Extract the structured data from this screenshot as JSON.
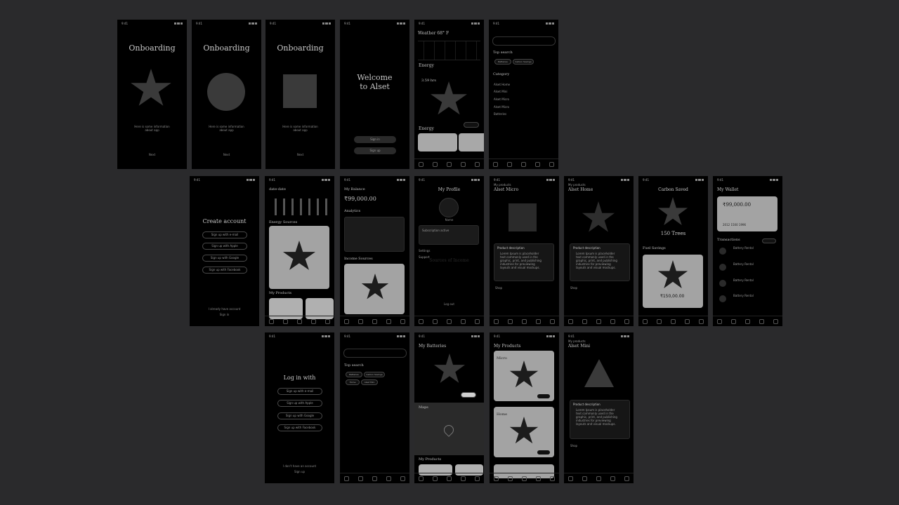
{
  "status_time": "9:41",
  "onboarding": {
    "title": "Onboarding",
    "info": "Here is some information about app",
    "next": "Next"
  },
  "welcome": {
    "title_line1": "Welcome",
    "title_line2": "to Alset",
    "sign_in": "Sign in",
    "sign_up": "Sign up"
  },
  "weather": {
    "title": "Weather 68° F",
    "energy": "Energy",
    "hours": "3.59 hrs",
    "energy2": "Energy"
  },
  "search": {
    "top_search": "Top search",
    "chips": [
      "Batteries",
      "Carbon Savings"
    ],
    "category": "Category",
    "categories": [
      "Alset Home",
      "Alset Mini",
      "Alset Micro",
      "Alset Micro",
      "Batteries"
    ]
  },
  "create_account": {
    "title": "Create account",
    "options": [
      "Sign up with e-mail",
      "Sign up with Apple",
      "Sign up with Google",
      "Sign up with Facebook"
    ],
    "already": "I already have account",
    "sign_in": "Sign in"
  },
  "dashboard": {
    "date": "date-date",
    "energy_sources": "Energy Sources",
    "my_products": "My Products"
  },
  "balance": {
    "title": "My Balance",
    "amount": "₹99,000.00",
    "analytics": "Analytics",
    "income_sources": "Income Sources"
  },
  "profile": {
    "title": "My Profile",
    "name": "Name",
    "subscription": "Subscription active",
    "settings": "Settings",
    "support": "Support",
    "sources": "Sources of Income",
    "logout": "Log out"
  },
  "alset_micro": {
    "back": "My products",
    "title": "Alset Micro",
    "desc_title": "Product description",
    "desc": "Lorem Ipsum is placeholder text commonly used in the graphic, print, and publishing industries for previewing layouts and visual mockups.",
    "shop": "Shop",
    "details": "Details"
  },
  "alset_home": {
    "back": "My products",
    "title": "Alset Home",
    "desc_title": "Product description",
    "desc": "Lorem Ipsum is placeholder text commonly used in the graphic, print, and publishing industries for previewing layouts and visual mockups.",
    "shop": "Shop",
    "details": "Details"
  },
  "carbon": {
    "title": "Carbon Saved",
    "trees": "150 Trees",
    "fuel": "Fuel Savings",
    "amount": "₹150,00.00"
  },
  "wallet": {
    "title": "My Wallet",
    "amount": "₹99,000.00",
    "card_no": "2012 1500 1996",
    "transactions": "Transactions",
    "tx": [
      {
        "title": "Battery Rental"
      },
      {
        "title": "Battery Rental"
      },
      {
        "title": "Battery Rental"
      },
      {
        "title": "Battery Rental"
      }
    ]
  },
  "login": {
    "title": "Log in with",
    "options": [
      "Sign up with e-mail",
      "Sign up with Apple",
      "Sign up with Google",
      "Sign up with Facebook"
    ],
    "no_account": "I don't have an account",
    "sign_up": "Sign up"
  },
  "search2": {
    "top_search": "Top search",
    "chips": [
      "Batteries",
      "Carbon Savings",
      "Home",
      "Alset Mini"
    ]
  },
  "batteries": {
    "title": "My Batteries",
    "maps": "Maps",
    "my_products": "My Products"
  },
  "products": {
    "title": "My Products",
    "item1": "Micro",
    "item2": "Home",
    "details": "Details"
  },
  "alset_mini": {
    "back": "My products",
    "title": "Alset Mini",
    "desc_title": "Product description",
    "desc": "Lorem Ipsum is placeholder text commonly used in the graphic, print, and publishing industries for previewing layouts and visual mockups.",
    "shop": "Shop",
    "details": "Details"
  }
}
